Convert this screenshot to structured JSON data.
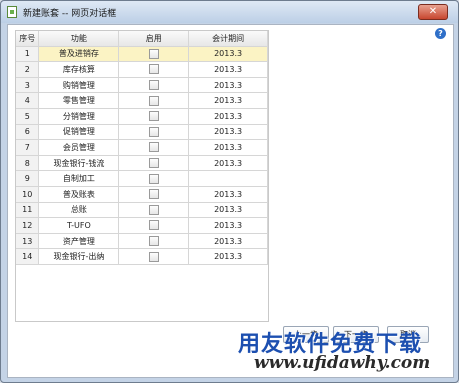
{
  "window": {
    "title": "新建账套 -- 网页对话框",
    "close_glyph": "✕"
  },
  "help": {
    "glyph": "?"
  },
  "table": {
    "headers": {
      "seq": "序号",
      "func": "功能",
      "enable": "启用",
      "period": "会计期间"
    },
    "rows": [
      {
        "seq": "1",
        "func": "普及进销存",
        "period": "2013.3"
      },
      {
        "seq": "2",
        "func": "库存核算",
        "period": "2013.3"
      },
      {
        "seq": "3",
        "func": "购销管理",
        "period": "2013.3"
      },
      {
        "seq": "4",
        "func": "零售管理",
        "period": "2013.3"
      },
      {
        "seq": "5",
        "func": "分销管理",
        "period": "2013.3"
      },
      {
        "seq": "6",
        "func": "促销管理",
        "period": "2013.3"
      },
      {
        "seq": "7",
        "func": "会员管理",
        "period": "2013.3"
      },
      {
        "seq": "8",
        "func": "现金银行-钱流",
        "period": "2013.3"
      },
      {
        "seq": "9",
        "func": "自制加工",
        "period": ""
      },
      {
        "seq": "10",
        "func": "普及账表",
        "period": "2013.3"
      },
      {
        "seq": "11",
        "func": "总账",
        "period": "2013.3"
      },
      {
        "seq": "12",
        "func": "T-UFO",
        "period": "2013.3"
      },
      {
        "seq": "13",
        "func": "资产管理",
        "period": "2013.3"
      },
      {
        "seq": "14",
        "func": "现金银行-出纳",
        "period": "2013.3"
      }
    ]
  },
  "buttons": {
    "prev": "上一步",
    "next": "下一步",
    "cancel": "取消"
  },
  "watermark": {
    "brand": "用友软件免费下载",
    "url": "www.ufidawhy.com"
  },
  "colors": {
    "selected_row": "#fbf3c4",
    "close_button": "#c7462f",
    "watermark_blue": "#1c4fb0"
  }
}
